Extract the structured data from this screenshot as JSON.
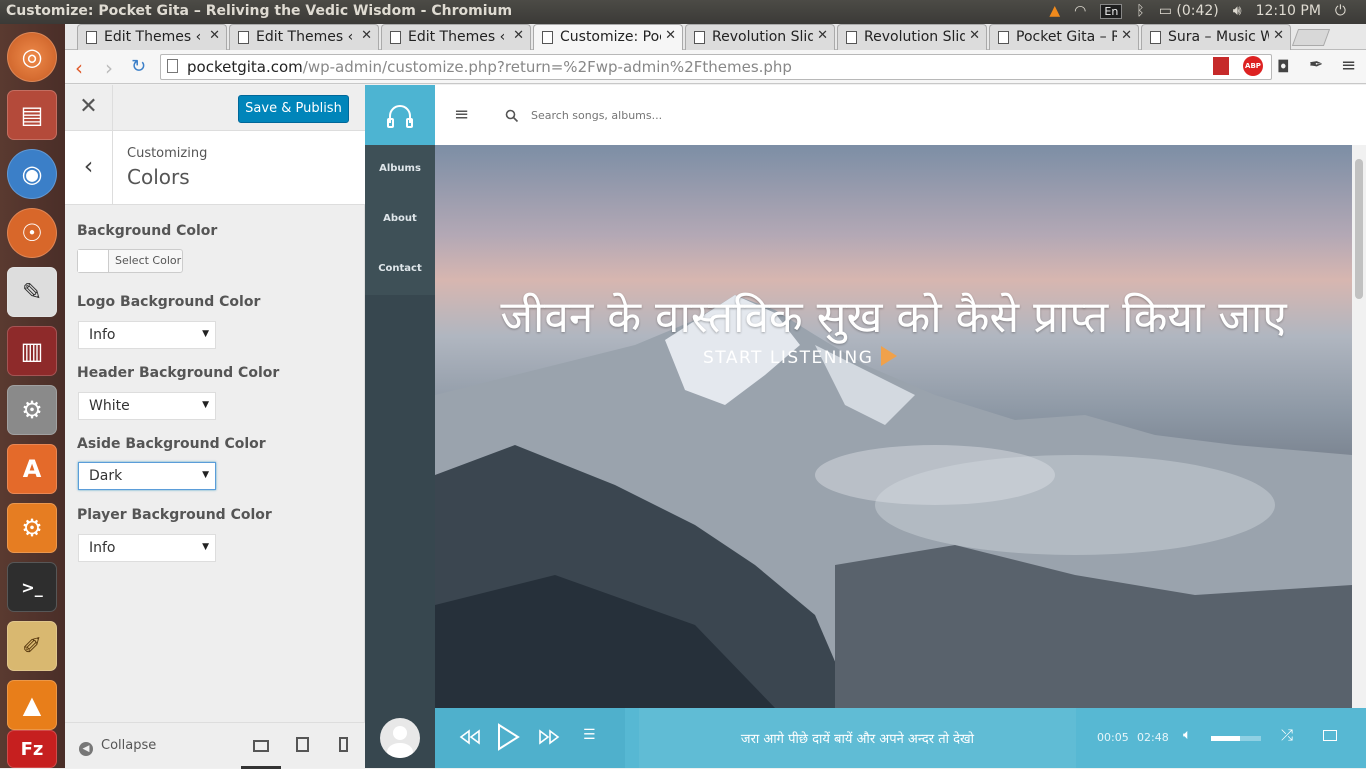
{
  "window": {
    "title": "Customize: Pocket Gita – Reliving the Vedic Wisdom - Chromium",
    "battery": "(0:42)",
    "keyboard": "En",
    "time": "12:10 PM"
  },
  "tabs": [
    {
      "label": "Edit Themes ‹ P"
    },
    {
      "label": "Edit Themes ‹ P"
    },
    {
      "label": "Edit Themes ‹ P"
    },
    {
      "label": "Customize: Poc"
    },
    {
      "label": "Revolution Slid"
    },
    {
      "label": "Revolution Slid"
    },
    {
      "label": "Pocket Gita – R"
    },
    {
      "label": "Sura – Music W"
    }
  ],
  "url": {
    "host": "pocketgita.com",
    "path": "/wp-admin/customize.php?return=%2Fwp-admin%2Fthemes.php"
  },
  "customizer": {
    "save_label": "Save & Publish",
    "customizing": "Customizing",
    "section": "Colors",
    "bg_label": "Background Color",
    "select_color": "Select Color",
    "logo_bg_label": "Logo Background Color",
    "logo_bg_value": "Info",
    "header_bg_label": "Header Background Color",
    "header_bg_value": "White",
    "aside_bg_label": "Aside Background Color",
    "aside_bg_value": "Dark",
    "player_bg_label": "Player Background Color",
    "player_bg_value": "Info",
    "collapse": "Collapse"
  },
  "site": {
    "search_placeholder": "Search songs, albums...",
    "nav": [
      "Albums",
      "About",
      "Contact"
    ],
    "hero_title": "जीवन के वास्तविक सुख को कैसे प्राप्त किया जाए",
    "hero_cta": "START LISTENING"
  },
  "player": {
    "track": "जरा आगे पीछे दायें बायें और अपने अन्दर तो देखो",
    "elapsed": "00:05",
    "duration": "02:48",
    "volume": 0.58
  },
  "colors": {
    "accent": "#0085ba",
    "info": "#4db4d2",
    "dark": "#37474f"
  }
}
